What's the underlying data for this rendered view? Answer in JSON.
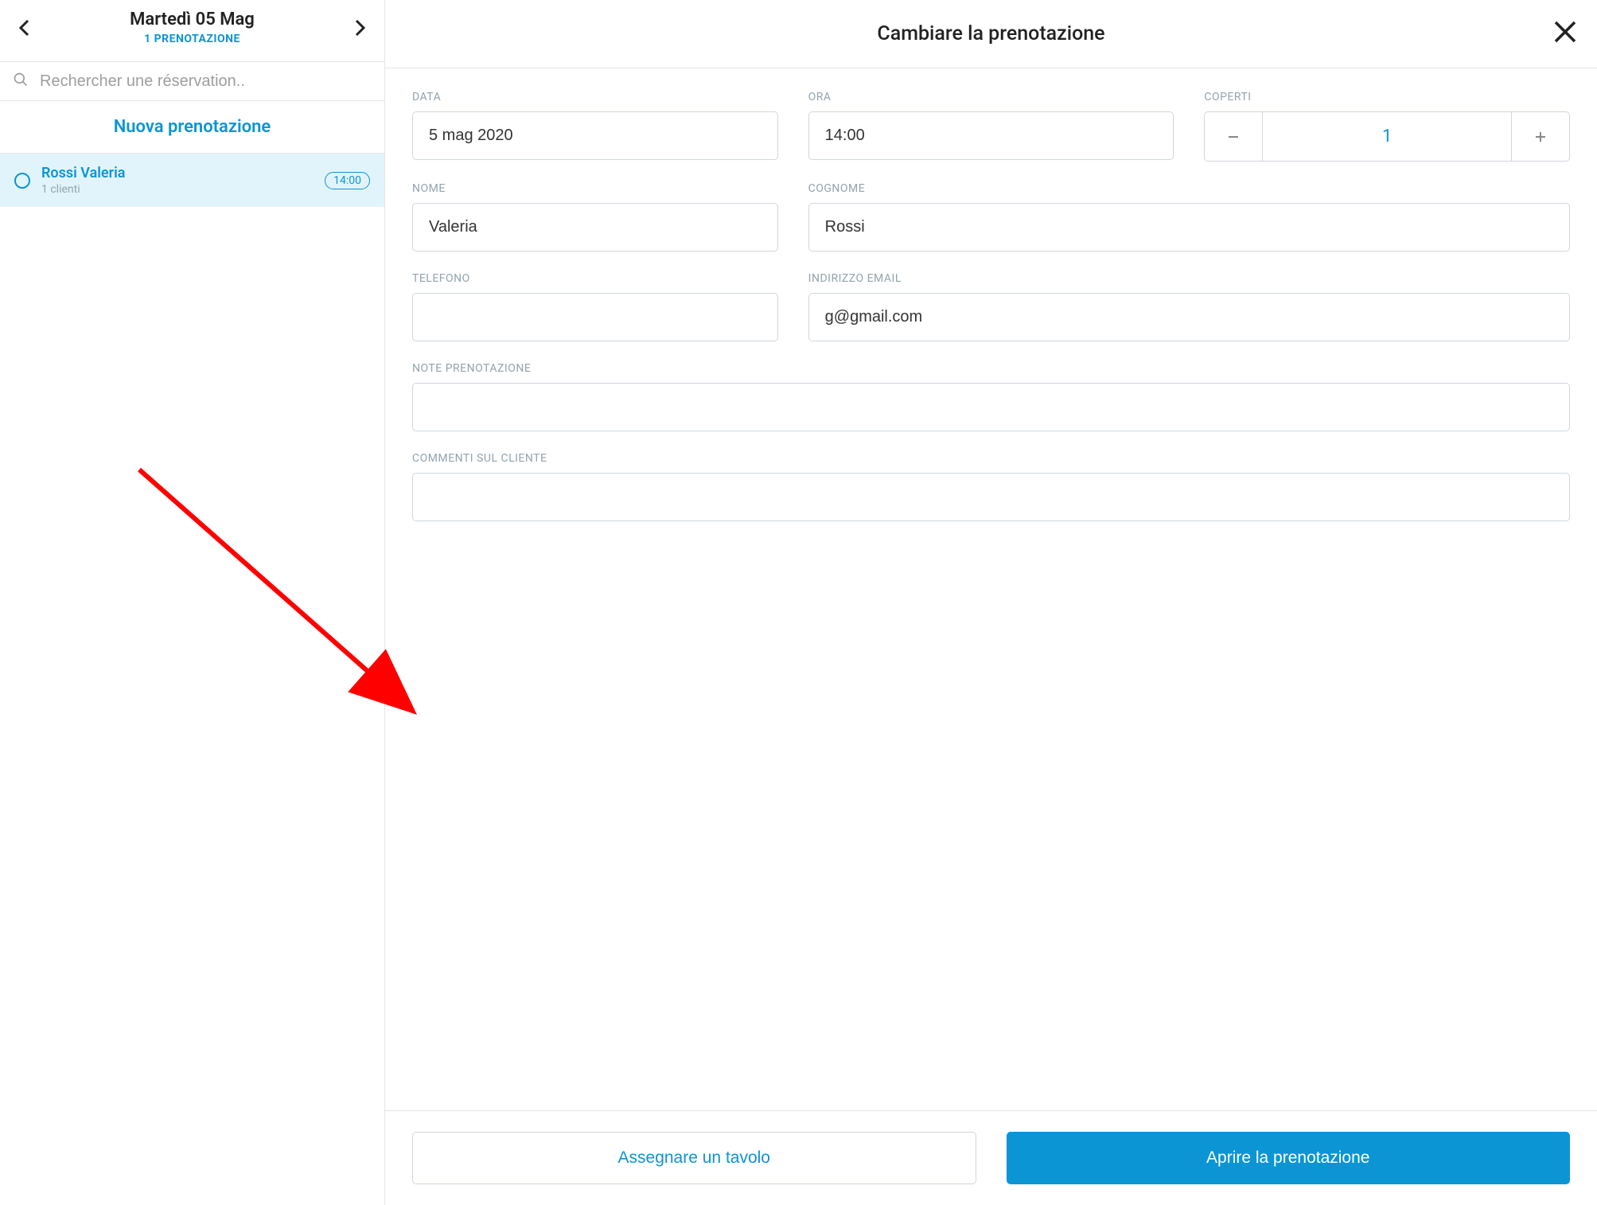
{
  "sidebar": {
    "date_title": "Martedì 05 Mag",
    "date_sub": "1 PRENOTAZIONE",
    "search_placeholder": "Rechercher une réservation..",
    "new_reservation": "Nuova prenotazione",
    "reservations": [
      {
        "name": "Rossi  Valeria",
        "sub": "1 clienti",
        "time": "14:00"
      }
    ]
  },
  "main": {
    "title": "Cambiare la prenotazione",
    "labels": {
      "data": "DATA",
      "ora": "ORA",
      "coperti": "COPERTI",
      "nome": "NOME",
      "cognome": "COGNOME",
      "telefono": "TELEFONO",
      "email": "INDIRIZZO EMAIL",
      "note": "NOTE PRENOTAZIONE",
      "commenti": "COMMENTI SUL CLIENTE"
    },
    "values": {
      "data": "5 mag 2020",
      "ora": "14:00",
      "coperti": "1",
      "nome": "Valeria",
      "cognome": "Rossi",
      "telefono": "",
      "email": "g@gmail.com",
      "note": "",
      "commenti": ""
    },
    "buttons": {
      "assign_table": "Assegnare un tavolo",
      "open_reservation": "Aprire la prenotazione"
    }
  }
}
